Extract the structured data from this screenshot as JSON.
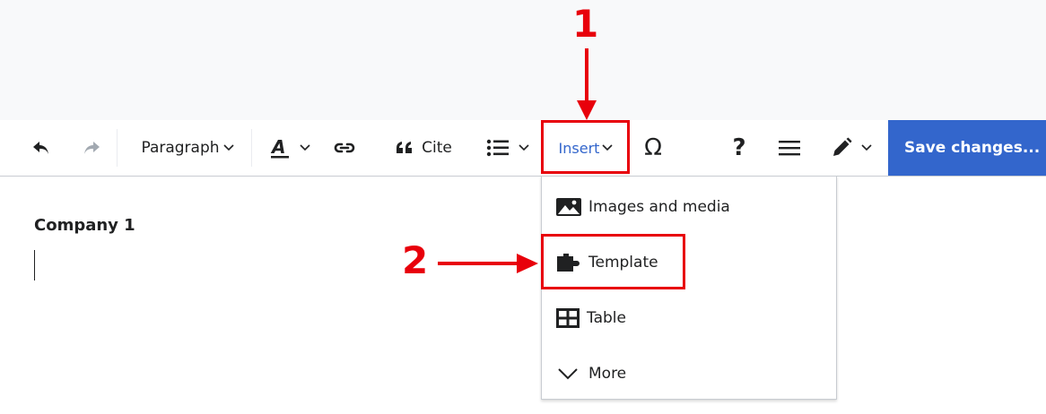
{
  "toolbar": {
    "undo_icon": "undo-arrow-icon",
    "redo_icon": "redo-arrow-icon",
    "paragraph_label": "Paragraph",
    "cite_label": "Cite",
    "insert_label": "Insert",
    "special_char": "Ω",
    "help_label": "?",
    "save_label": "Save changes...",
    "colors": {
      "accent": "#3366cc",
      "annotation": "#e8000b"
    }
  },
  "content": {
    "heading": "Company 1"
  },
  "insert_menu": {
    "items": [
      {
        "label": "Images and media",
        "icon": "image-icon"
      },
      {
        "label": "Template",
        "icon": "puzzle-icon"
      },
      {
        "label": "Table",
        "icon": "table-icon"
      },
      {
        "label": "More",
        "icon": "chevron-down-icon"
      }
    ]
  },
  "annotations": {
    "step1": "1",
    "step2": "2"
  }
}
